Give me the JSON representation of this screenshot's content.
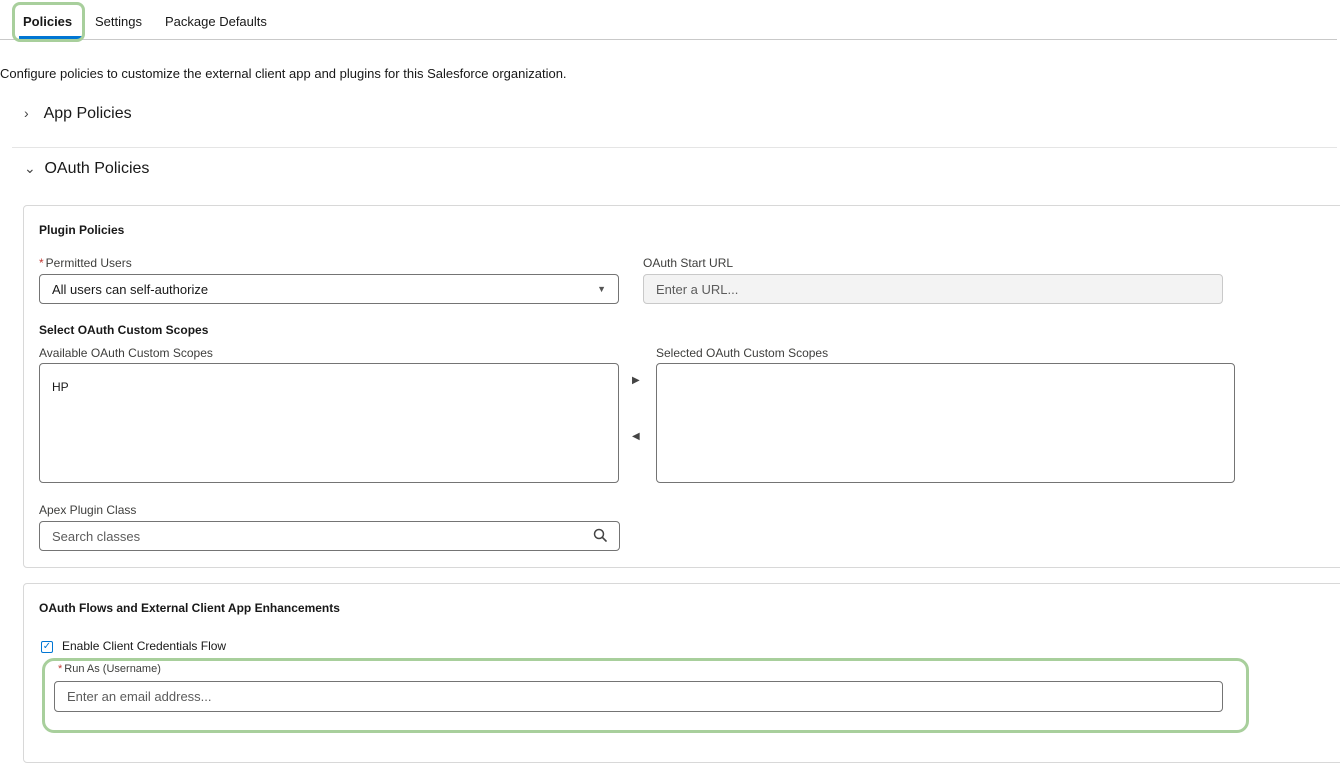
{
  "tabs": [
    {
      "label": "Policies",
      "active": true
    },
    {
      "label": "Settings",
      "active": false
    },
    {
      "label": "Package Defaults",
      "active": false
    }
  ],
  "intro_text": "Configure policies to customize the external client app and plugins for this Salesforce organization.",
  "sections": {
    "app_policies": {
      "label": "App Policies",
      "expanded": false,
      "icon": "chevron-right-icon"
    },
    "oauth_policies": {
      "label": "OAuth Policies",
      "expanded": true,
      "icon": "chevron-down-icon"
    }
  },
  "plugin_policies": {
    "title": "Plugin Policies",
    "permitted_users": {
      "required": "*",
      "label": "Permitted Users",
      "value": "All users can self-authorize"
    },
    "oauth_start_url": {
      "label": "OAuth Start URL",
      "placeholder": "Enter a URL..."
    },
    "custom_scopes": {
      "title": "Select OAuth Custom Scopes",
      "available_label": "Available OAuth Custom Scopes",
      "available_items": [
        "HP"
      ],
      "selected_label": "Selected OAuth Custom Scopes",
      "selected_items": []
    },
    "apex_plugin_class": {
      "label": "Apex Plugin Class",
      "placeholder": "Search classes"
    }
  },
  "oauth_flows": {
    "title": "OAuth Flows and External Client App Enhancements",
    "client_credentials": {
      "label": "Enable Client Credentials Flow",
      "checked": true
    },
    "run_as": {
      "required": "*",
      "label": "Run As (Username)",
      "placeholder": "Enter an email address..."
    }
  },
  "colors": {
    "accent": "#0176d3",
    "highlight": "#a8cf9c",
    "required": "#c23934"
  }
}
